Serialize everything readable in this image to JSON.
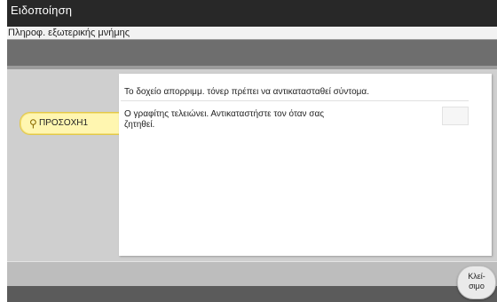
{
  "window": {
    "title": "Ειδοποίηση",
    "subtitle": "Πληροφ. εξωτερικής μνήμης"
  },
  "warning": {
    "label": "ΠΡΟΣΟΧΗ1",
    "icon": "warning-icon"
  },
  "message": {
    "line1": "Το δοχείο απορριμμ. τόνερ πρέπει να αντικατασταθεί σύντομα.",
    "line2": "Ο γραφίτης τελειώνει. Αντικαταστήστε τον όταν σας ζητηθεί."
  },
  "footer": {
    "close_label_line1": "Κλεί-",
    "close_label_line2": "σιμο"
  },
  "colors": {
    "titlebar": "#282828",
    "warning_tab": "#fff6b0",
    "panel": "#c9c9c9"
  }
}
